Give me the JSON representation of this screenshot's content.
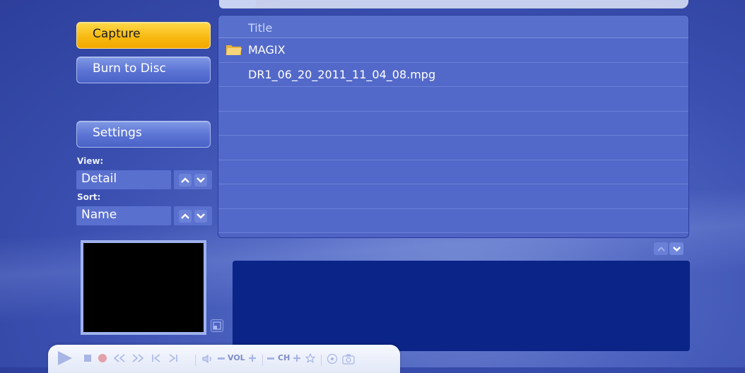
{
  "sidebar": {
    "capture_label": "Capture",
    "burn_label": "Burn to Disc",
    "settings_label": "Settings",
    "view_label": "View:",
    "view_value": "Detail",
    "sort_label": "Sort:",
    "sort_value": "Name"
  },
  "list": {
    "header": "Title",
    "rows": [
      {
        "name": "MAGIX",
        "icon": "folder-icon"
      },
      {
        "name": "DR1_06_20_2011_11_04_08.mpg",
        "icon": ""
      }
    ]
  },
  "transport": {
    "vol_label": "VOL",
    "ch_label": "CH"
  },
  "colors": {
    "accent": "#f7b80f",
    "background": "#3a4fb0",
    "info_panel": "#0b2488"
  }
}
